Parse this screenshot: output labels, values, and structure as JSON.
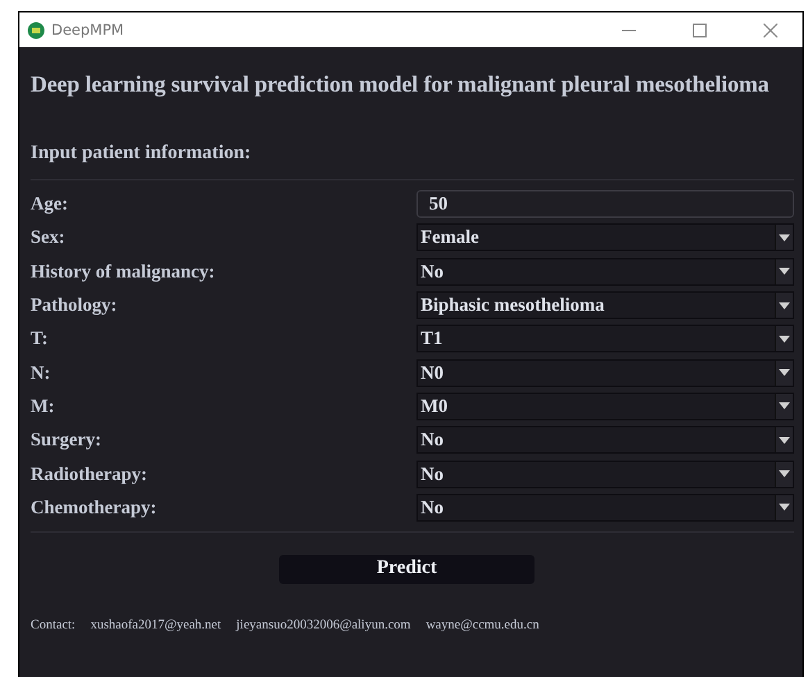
{
  "window": {
    "title": "DeepMPM"
  },
  "heading": "Deep learning survival prediction model for malignant pleural mesothelioma",
  "section_title": "Input patient information:",
  "fields": [
    {
      "label": "Age:",
      "kind": "text",
      "value": "50"
    },
    {
      "label": "Sex:",
      "kind": "select",
      "value": "Female"
    },
    {
      "label": "History of malignancy:",
      "kind": "select",
      "value": "No"
    },
    {
      "label": "Pathology:",
      "kind": "select",
      "value": "Biphasic mesothelioma"
    },
    {
      "label": "T:",
      "kind": "select",
      "value": "T1"
    },
    {
      "label": "N:",
      "kind": "select",
      "value": "N0"
    },
    {
      "label": "M:",
      "kind": "select",
      "value": "M0"
    },
    {
      "label": "Surgery:",
      "kind": "select",
      "value": "No"
    },
    {
      "label": "Radiotherapy:",
      "kind": "select",
      "value": "No"
    },
    {
      "label": "Chemotherapy:",
      "kind": "select",
      "value": "No"
    }
  ],
  "predict_button": "Predict",
  "contact": {
    "label": "Contact:",
    "emails": [
      "xushaofa2017@yeah.net",
      "jieyansuo20032006@aliyun.com",
      "wayne@ccmu.edu.cn"
    ]
  }
}
